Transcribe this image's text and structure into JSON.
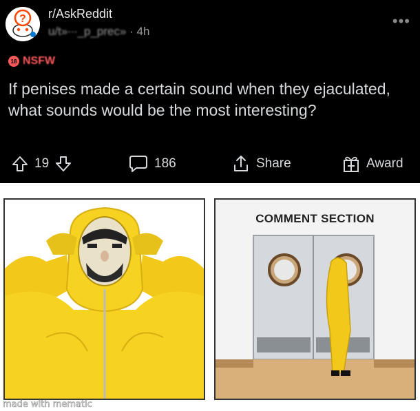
{
  "post": {
    "subreddit": "r/AskReddit",
    "username": "u/t»∙­∙∙_p_prec»",
    "age": "4h",
    "more": "•••",
    "nsfw_badge": "18",
    "nsfw_label": "NSFW",
    "title": "If penises made a certain sound when they ejaculated, what sounds would be the most interesting?"
  },
  "actions": {
    "votes": "19",
    "comments": "186",
    "share": "Share",
    "award": "Award"
  },
  "meme": {
    "comment_section": "COMMENT SECTION",
    "watermark": "made with mematic"
  },
  "colors": {
    "background": "#000000",
    "text": "#d7dadc",
    "nsfw": "#ff585b",
    "hazmat_yellow": "#f3d21c"
  }
}
